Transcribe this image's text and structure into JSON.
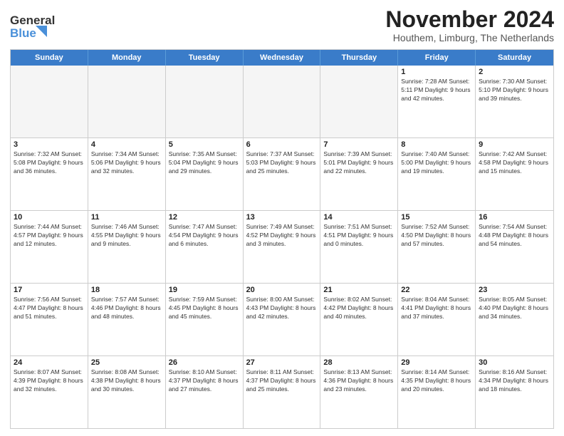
{
  "logo": {
    "line1": "General",
    "line2": "Blue"
  },
  "title": "November 2024",
  "subtitle": "Houthem, Limburg, The Netherlands",
  "weekdays": [
    "Sunday",
    "Monday",
    "Tuesday",
    "Wednesday",
    "Thursday",
    "Friday",
    "Saturday"
  ],
  "weeks": [
    [
      {
        "day": "",
        "info": "",
        "empty": true
      },
      {
        "day": "",
        "info": "",
        "empty": true
      },
      {
        "day": "",
        "info": "",
        "empty": true
      },
      {
        "day": "",
        "info": "",
        "empty": true
      },
      {
        "day": "",
        "info": "",
        "empty": true
      },
      {
        "day": "1",
        "info": "Sunrise: 7:28 AM\nSunset: 5:11 PM\nDaylight: 9 hours\nand 42 minutes.",
        "empty": false
      },
      {
        "day": "2",
        "info": "Sunrise: 7:30 AM\nSunset: 5:10 PM\nDaylight: 9 hours\nand 39 minutes.",
        "empty": false
      }
    ],
    [
      {
        "day": "3",
        "info": "Sunrise: 7:32 AM\nSunset: 5:08 PM\nDaylight: 9 hours\nand 36 minutes.",
        "empty": false
      },
      {
        "day": "4",
        "info": "Sunrise: 7:34 AM\nSunset: 5:06 PM\nDaylight: 9 hours\nand 32 minutes.",
        "empty": false
      },
      {
        "day": "5",
        "info": "Sunrise: 7:35 AM\nSunset: 5:04 PM\nDaylight: 9 hours\nand 29 minutes.",
        "empty": false
      },
      {
        "day": "6",
        "info": "Sunrise: 7:37 AM\nSunset: 5:03 PM\nDaylight: 9 hours\nand 25 minutes.",
        "empty": false
      },
      {
        "day": "7",
        "info": "Sunrise: 7:39 AM\nSunset: 5:01 PM\nDaylight: 9 hours\nand 22 minutes.",
        "empty": false
      },
      {
        "day": "8",
        "info": "Sunrise: 7:40 AM\nSunset: 5:00 PM\nDaylight: 9 hours\nand 19 minutes.",
        "empty": false
      },
      {
        "day": "9",
        "info": "Sunrise: 7:42 AM\nSunset: 4:58 PM\nDaylight: 9 hours\nand 15 minutes.",
        "empty": false
      }
    ],
    [
      {
        "day": "10",
        "info": "Sunrise: 7:44 AM\nSunset: 4:57 PM\nDaylight: 9 hours\nand 12 minutes.",
        "empty": false
      },
      {
        "day": "11",
        "info": "Sunrise: 7:46 AM\nSunset: 4:55 PM\nDaylight: 9 hours\nand 9 minutes.",
        "empty": false
      },
      {
        "day": "12",
        "info": "Sunrise: 7:47 AM\nSunset: 4:54 PM\nDaylight: 9 hours\nand 6 minutes.",
        "empty": false
      },
      {
        "day": "13",
        "info": "Sunrise: 7:49 AM\nSunset: 4:52 PM\nDaylight: 9 hours\nand 3 minutes.",
        "empty": false
      },
      {
        "day": "14",
        "info": "Sunrise: 7:51 AM\nSunset: 4:51 PM\nDaylight: 9 hours\nand 0 minutes.",
        "empty": false
      },
      {
        "day": "15",
        "info": "Sunrise: 7:52 AM\nSunset: 4:50 PM\nDaylight: 8 hours\nand 57 minutes.",
        "empty": false
      },
      {
        "day": "16",
        "info": "Sunrise: 7:54 AM\nSunset: 4:48 PM\nDaylight: 8 hours\nand 54 minutes.",
        "empty": false
      }
    ],
    [
      {
        "day": "17",
        "info": "Sunrise: 7:56 AM\nSunset: 4:47 PM\nDaylight: 8 hours\nand 51 minutes.",
        "empty": false
      },
      {
        "day": "18",
        "info": "Sunrise: 7:57 AM\nSunset: 4:46 PM\nDaylight: 8 hours\nand 48 minutes.",
        "empty": false
      },
      {
        "day": "19",
        "info": "Sunrise: 7:59 AM\nSunset: 4:45 PM\nDaylight: 8 hours\nand 45 minutes.",
        "empty": false
      },
      {
        "day": "20",
        "info": "Sunrise: 8:00 AM\nSunset: 4:43 PM\nDaylight: 8 hours\nand 42 minutes.",
        "empty": false
      },
      {
        "day": "21",
        "info": "Sunrise: 8:02 AM\nSunset: 4:42 PM\nDaylight: 8 hours\nand 40 minutes.",
        "empty": false
      },
      {
        "day": "22",
        "info": "Sunrise: 8:04 AM\nSunset: 4:41 PM\nDaylight: 8 hours\nand 37 minutes.",
        "empty": false
      },
      {
        "day": "23",
        "info": "Sunrise: 8:05 AM\nSunset: 4:40 PM\nDaylight: 8 hours\nand 34 minutes.",
        "empty": false
      }
    ],
    [
      {
        "day": "24",
        "info": "Sunrise: 8:07 AM\nSunset: 4:39 PM\nDaylight: 8 hours\nand 32 minutes.",
        "empty": false
      },
      {
        "day": "25",
        "info": "Sunrise: 8:08 AM\nSunset: 4:38 PM\nDaylight: 8 hours\nand 30 minutes.",
        "empty": false
      },
      {
        "day": "26",
        "info": "Sunrise: 8:10 AM\nSunset: 4:37 PM\nDaylight: 8 hours\nand 27 minutes.",
        "empty": false
      },
      {
        "day": "27",
        "info": "Sunrise: 8:11 AM\nSunset: 4:37 PM\nDaylight: 8 hours\nand 25 minutes.",
        "empty": false
      },
      {
        "day": "28",
        "info": "Sunrise: 8:13 AM\nSunset: 4:36 PM\nDaylight: 8 hours\nand 23 minutes.",
        "empty": false
      },
      {
        "day": "29",
        "info": "Sunrise: 8:14 AM\nSunset: 4:35 PM\nDaylight: 8 hours\nand 20 minutes.",
        "empty": false
      },
      {
        "day": "30",
        "info": "Sunrise: 8:16 AM\nSunset: 4:34 PM\nDaylight: 8 hours\nand 18 minutes.",
        "empty": false
      }
    ]
  ]
}
